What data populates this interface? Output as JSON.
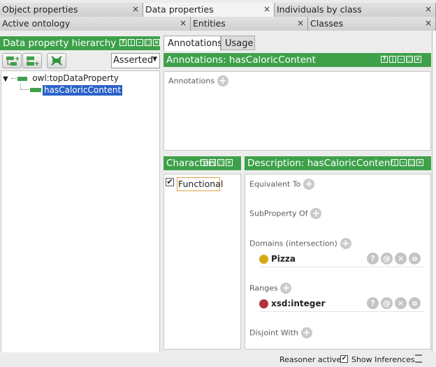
{
  "tabs_row1": [
    "Object properties",
    "Data properties",
    "Individuals by class"
  ],
  "tabs_row2": [
    "Active ontology",
    "Entities",
    "Classes"
  ],
  "close_glyph": "×",
  "hierarchy": {
    "title": "Data property hierarchy",
    "mode_select": "Asserted",
    "root": "owl:topDataProperty",
    "selected": "hasCaloricContent"
  },
  "view_tabs": [
    "Annotations",
    "Usage"
  ],
  "annotations_panel": {
    "title": "Annotations: hasCaloricContent",
    "label": "Annotations"
  },
  "characteristics": {
    "title": "Characteri",
    "item": "Functional",
    "checked": true
  },
  "description": {
    "title": "Description: hasCaloricContent",
    "sections": {
      "equivalent": "Equivalent To",
      "subproperty": "SubProperty Of",
      "domains": "Domains (intersection)",
      "ranges": "Ranges",
      "disjoint": "Disjoint With"
    },
    "domain_item": "Pizza",
    "range_item": "xsd:integer"
  },
  "colors": {
    "accent_green": "#3ea14a",
    "selection_blue": "#2a62c9",
    "class_gold": "#d6a813",
    "datatype_red": "#b0333a"
  },
  "status": {
    "reasoner": "Reasoner active",
    "show_inferences": "Show Inferences"
  }
}
